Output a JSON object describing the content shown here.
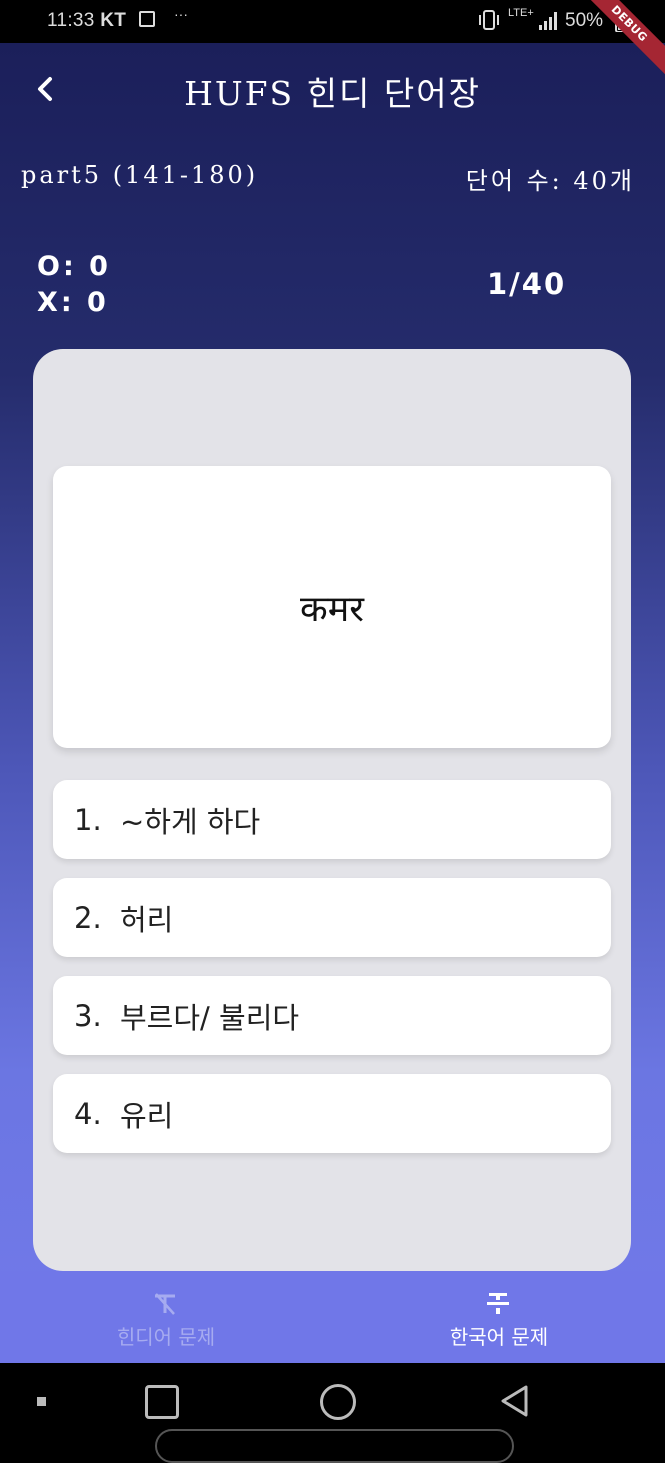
{
  "status_bar": {
    "time": "11:33",
    "carrier": "KT",
    "more": "···",
    "network": "LTE+",
    "battery": "50%",
    "debug_banner": "DEBUG"
  },
  "app_bar": {
    "title": "HUFS 힌디 단어장"
  },
  "info": {
    "part": "part5 (141-180)",
    "word_count": "단어 수: 40개"
  },
  "score": {
    "correct": "O: 0",
    "wrong": "X: 0"
  },
  "progress": "1/40",
  "question": {
    "word": "कमर"
  },
  "options": [
    {
      "num": "1.",
      "text": "~하게 하다"
    },
    {
      "num": "2.",
      "text": "허리"
    },
    {
      "num": "3.",
      "text": "부르다/ 불리다"
    },
    {
      "num": "4.",
      "text": "유리"
    }
  ],
  "bottom_nav": {
    "hindi_label": "힌디어 문제",
    "korean_label": "한국어 문제",
    "selected": "korean"
  },
  "colors": {
    "gradient_top": "#1b1f5a",
    "gradient_bottom": "#7279ea",
    "card_bg": "#e3e3e8",
    "nav_bg": "#7077e8"
  }
}
